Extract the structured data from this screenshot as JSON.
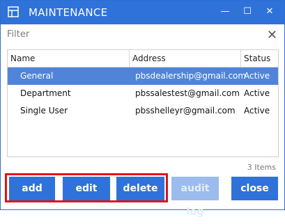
{
  "window": {
    "title": "MAINTENANCE",
    "controls": {
      "minimize": "—",
      "maximize": "☐",
      "close": "✕"
    }
  },
  "filter": {
    "placeholder": "Filter",
    "clear_glyph": "✕"
  },
  "grid": {
    "columns": [
      "Name",
      "Address",
      "Status"
    ],
    "rows": [
      {
        "name": "General",
        "address": "pbsdealership@gmail.com",
        "status": "Active",
        "selected": true
      },
      {
        "name": "Department",
        "address": "pbssalestest@gmail.com",
        "status": "Active",
        "selected": false
      },
      {
        "name": "Single User",
        "address": "pbsshelleyr@gmail.com",
        "status": "Active",
        "selected": false
      }
    ]
  },
  "item_count": "3 Items",
  "buttons": {
    "add": "add",
    "edit": "edit",
    "delete": "delete",
    "audit_log": "audit log",
    "close": "close"
  },
  "colors": {
    "accent": "#2f72da",
    "selected_row": "#4f84d8",
    "highlight": "#e0121b",
    "disabled_button": "#9bbcec"
  }
}
